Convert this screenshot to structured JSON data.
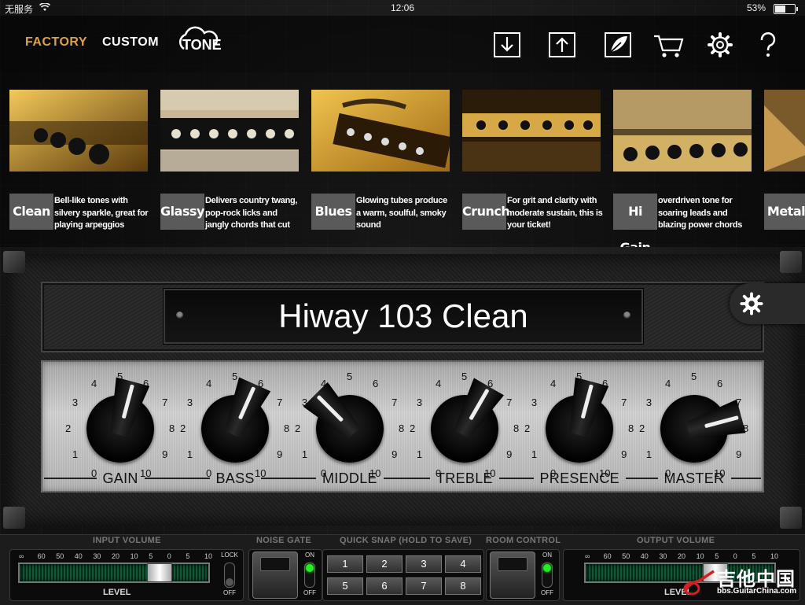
{
  "status_bar": {
    "carrier": "无服务",
    "time": "12:06",
    "battery": "53%",
    "battery_level": 0.53
  },
  "nav": {
    "tabs": [
      {
        "label": "FACTORY",
        "active": true
      },
      {
        "label": "CUSTOM",
        "active": false
      }
    ],
    "tone_label": "TONE",
    "icons": [
      "download-icon",
      "upload-icon",
      "tone-logo-icon",
      "cart-icon",
      "gear-icon",
      "help-icon"
    ],
    "accent_color": "#d9a24a"
  },
  "presets": [
    {
      "name": "Clean",
      "description": "Bell-like tones with silvery sparkle, great for playing arpeggios"
    },
    {
      "name": "Glassy",
      "description": "Delivers country twang, pop-rock licks and jangly chords that cut"
    },
    {
      "name": "Blues",
      "description": "Glowing tubes produce a warm, soulful, smoky sound"
    },
    {
      "name": "Crunch",
      "description": "For grit and clarity with moderate sustain, this is your ticket!"
    },
    {
      "name": "Hi Gain",
      "description": "overdriven tone for soaring leads and blazing power chords"
    },
    {
      "name": "Metal",
      "description": ""
    }
  ],
  "amp": {
    "preset_name": "Hiway 103 Clean",
    "knobs": [
      {
        "label": "GAIN",
        "value": 5.5
      },
      {
        "label": "BASS",
        "value": 5.8
      },
      {
        "label": "MIDDLE",
        "value": 3.5
      },
      {
        "label": "TREBLE",
        "value": 6.0
      },
      {
        "label": "PRESENCE",
        "value": 5.5
      },
      {
        "label": "MASTER",
        "value": 7.5
      }
    ],
    "scale": [
      "0",
      "1",
      "2",
      "3",
      "4",
      "5",
      "6",
      "7",
      "8",
      "9",
      "10"
    ]
  },
  "controls": {
    "input_volume": {
      "title": "INPUT VOLUME",
      "level_label": "LEVEL",
      "scale": [
        "∞",
        "60",
        "50",
        "40",
        "30",
        "20",
        "10",
        "5",
        "0",
        "5",
        "10"
      ],
      "level": 0.78,
      "lock_label": "LOCK",
      "off_label": "OFF"
    },
    "noise_gate": {
      "title": "NOISE GATE",
      "on_label": "ON",
      "off_label": "OFF",
      "state": "on"
    },
    "quick_snap": {
      "title": "QUICK SNAP (HOLD TO SAVE)",
      "buttons": [
        "1",
        "2",
        "3",
        "4",
        "5",
        "6",
        "7",
        "8"
      ]
    },
    "room_control": {
      "title": "ROOM CONTROL",
      "on_label": "ON",
      "off_label": "OFF",
      "state": "on"
    },
    "output_volume": {
      "title": "OUTPUT VOLUME",
      "level_label": "LEVEL",
      "scale": [
        "∞",
        "60",
        "50",
        "40",
        "30",
        "20",
        "10",
        "5",
        "0",
        "5",
        "10"
      ],
      "level": 0.72
    }
  },
  "watermark": {
    "text": "吉他中国",
    "url": "bbs.GuitarChina.com"
  }
}
